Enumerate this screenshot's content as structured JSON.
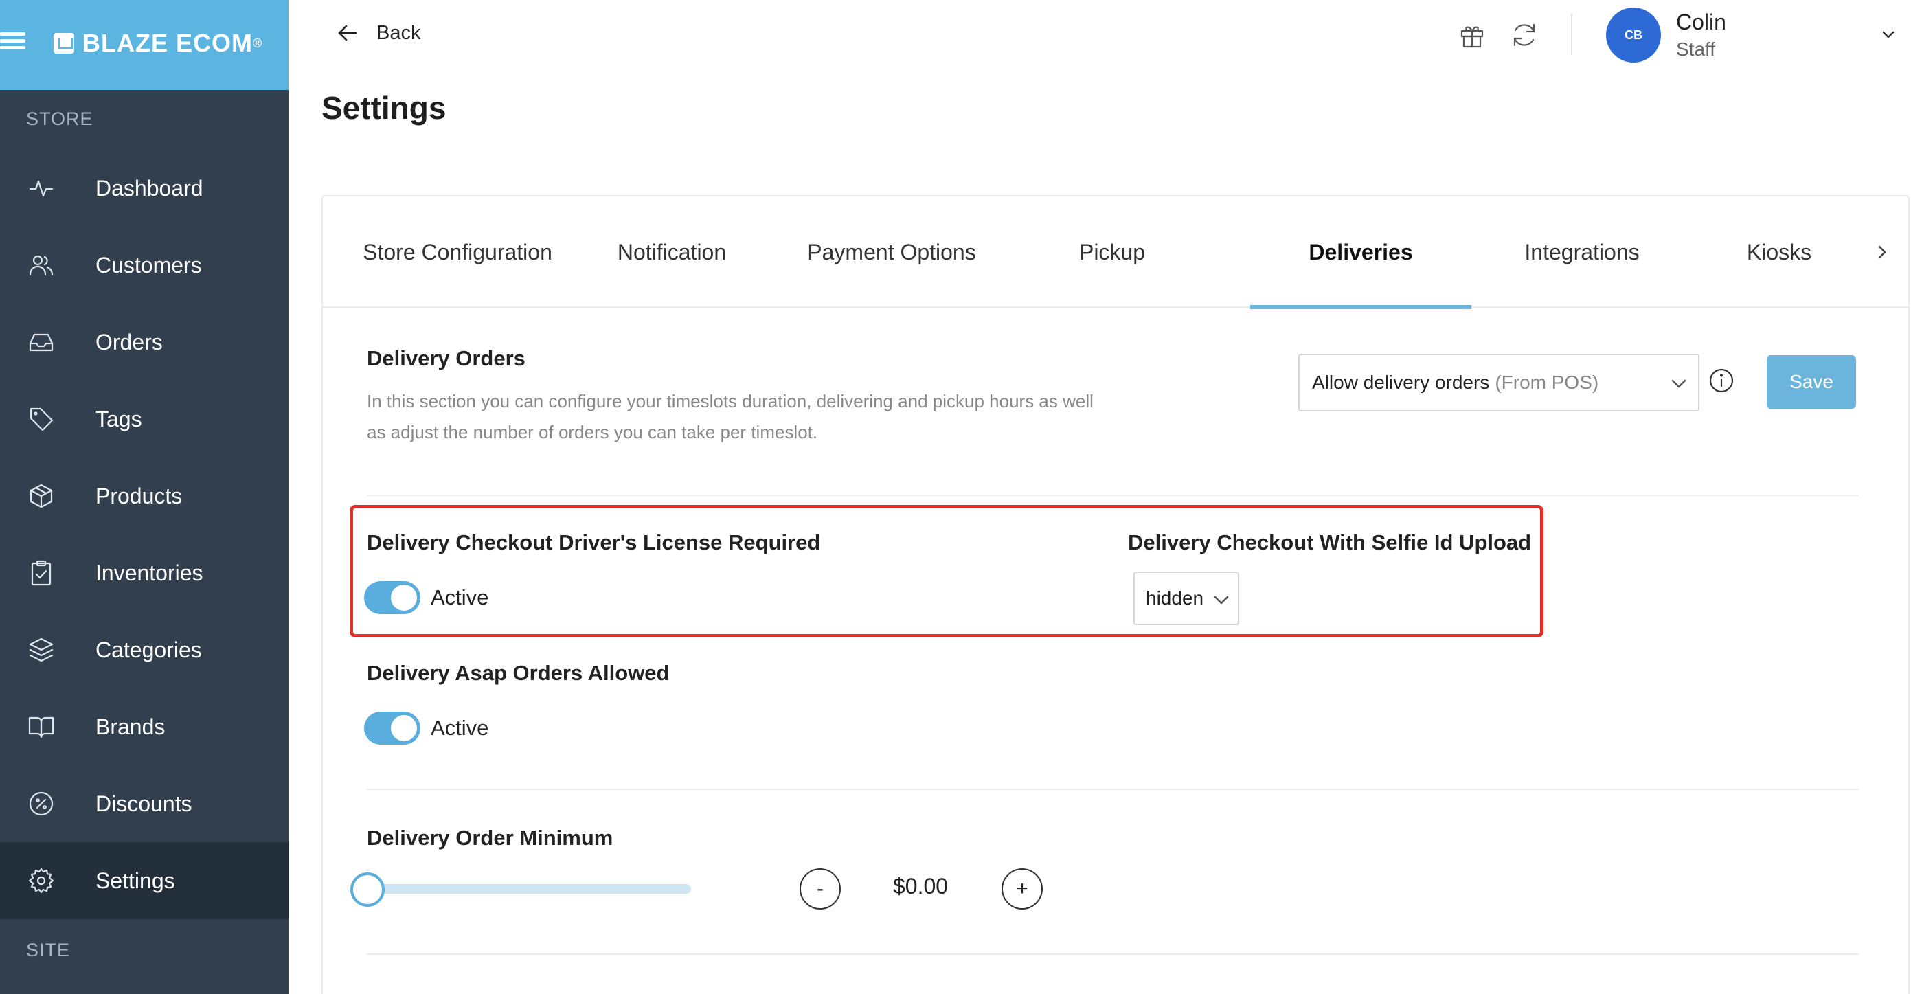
{
  "brand": {
    "name": "BLAZE ECOM",
    "trademark": "®"
  },
  "sidebar": {
    "store_label": "STORE",
    "site_label": "SITE",
    "items": [
      {
        "label": "Dashboard",
        "icon": "activity-icon"
      },
      {
        "label": "Customers",
        "icon": "users-icon"
      },
      {
        "label": "Orders",
        "icon": "inbox-icon"
      },
      {
        "label": "Tags",
        "icon": "tag-icon"
      },
      {
        "label": "Products",
        "icon": "box-icon"
      },
      {
        "label": "Inventories",
        "icon": "clipboard-icon"
      },
      {
        "label": "Categories",
        "icon": "layers-icon"
      },
      {
        "label": "Brands",
        "icon": "book-icon"
      },
      {
        "label": "Discounts",
        "icon": "percent-icon"
      },
      {
        "label": "Settings",
        "icon": "gear-icon",
        "active": true
      }
    ]
  },
  "header": {
    "back_label": "Back",
    "title": "Settings",
    "user": {
      "initials": "CB",
      "name": "Colin",
      "role": "Staff"
    }
  },
  "tabs": [
    {
      "label": "Store Configuration"
    },
    {
      "label": "Notification"
    },
    {
      "label": "Payment Options"
    },
    {
      "label": "Pickup"
    },
    {
      "label": "Deliveries",
      "active": true
    },
    {
      "label": "Integrations"
    },
    {
      "label": "Kiosks"
    }
  ],
  "delivery_orders": {
    "title": "Delivery Orders",
    "description": "In this section you can configure your timeslots duration, delivering and pickup hours as well as adjust the number of orders you can take per timeslot.",
    "select_value": "Allow delivery orders",
    "select_suffix": "(From POS)",
    "save_label": "Save"
  },
  "drivers_license": {
    "title": "Delivery Checkout Driver's License Required",
    "toggle_label": "Active",
    "toggle_on": true
  },
  "selfie_upload": {
    "title": "Delivery Checkout With Selfie Id Upload",
    "select_value": "hidden"
  },
  "asap_orders": {
    "title": "Delivery Asap Orders Allowed",
    "toggle_label": "Active",
    "toggle_on": true
  },
  "order_minimum": {
    "title": "Delivery Order Minimum",
    "decrement_label": "-",
    "increment_label": "+",
    "amount": "$0.00",
    "slider_fraction": 0
  },
  "colors": {
    "sidebar_bg": "#323f4f",
    "brand_bar": "#5cb4e0",
    "accent": "#6bb4dc",
    "highlight_border": "#e0302a",
    "avatar_bg": "#2d6ad6"
  }
}
